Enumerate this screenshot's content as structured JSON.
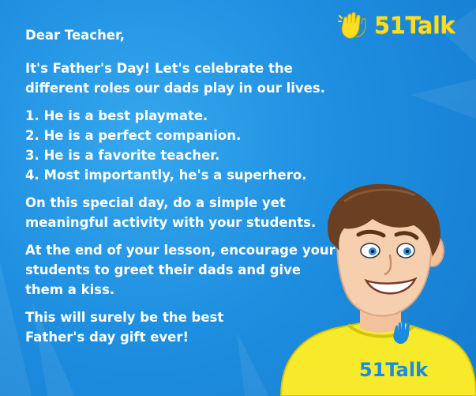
{
  "letter": {
    "greeting": "Dear Teacher,",
    "intro": "It's Father's Day!  Let's celebrate the different roles our dads play in our lives.",
    "list": [
      "1. He is a best playmate.",
      "2. He is a perfect companion.",
      "3. He is a favorite teacher.",
      "4. Most importantly, he's a superhero."
    ],
    "activity": "On this special day, do a simple yet meaningful activity with your students.",
    "closing": "At the end of your lesson, encourage your students to greet their dads and give them a kiss.",
    "gift": "This will surely be the best Father's day gift ever!"
  },
  "brand": {
    "logo_text": "51Talk",
    "shirt_logo_text": "51Talk"
  },
  "colors": {
    "background": "#1f8fe0",
    "text": "#ffffff",
    "brand_yellow": "#ffde1f"
  },
  "icons": {
    "logo": "waving-hands-icon",
    "character": "superhero-dad-cartoon"
  }
}
